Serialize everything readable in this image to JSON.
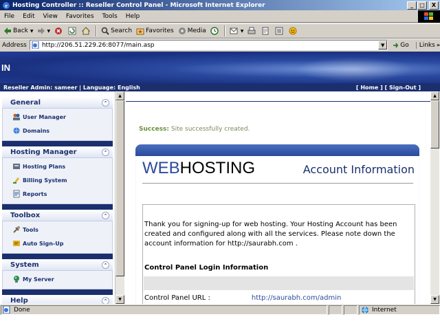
{
  "window": {
    "title": "Hosting Controller :: Reseller Control Panel - Microsoft Internet Explorer",
    "minimize": "_",
    "maximize": "□",
    "close": "X"
  },
  "menubar": {
    "items": [
      "File",
      "Edit",
      "View",
      "Favorites",
      "Tools",
      "Help"
    ]
  },
  "toolbar": {
    "back": "Back",
    "search": "Search",
    "favorites": "Favorites",
    "media": "Media"
  },
  "address": {
    "label": "Address",
    "url": "http://206.51.229.26:8077/main.asp",
    "go": "Go",
    "links": "Links"
  },
  "banner": {
    "logo": "IN"
  },
  "userbar": {
    "left": "Reseller Admin: sameer | Language: English",
    "right": "[ Home ] [ Sign-Out ]"
  },
  "sidebar": {
    "sections": [
      {
        "title": "General",
        "items": [
          {
            "label": "User Manager",
            "icon": "users-icon"
          },
          {
            "label": "Domains",
            "icon": "domains-icon"
          }
        ]
      },
      {
        "title": "Hosting Manager",
        "items": [
          {
            "label": "Hosting Plans",
            "icon": "plans-icon"
          },
          {
            "label": "Billing System",
            "icon": "billing-icon"
          },
          {
            "label": "Reports",
            "icon": "reports-icon"
          }
        ]
      },
      {
        "title": "Toolbox",
        "items": [
          {
            "label": "Tools",
            "icon": "tools-icon"
          },
          {
            "label": "Auto Sign-Up",
            "icon": "signup-icon"
          }
        ]
      },
      {
        "title": "System",
        "items": [
          {
            "label": "My Server",
            "icon": "server-icon"
          }
        ]
      },
      {
        "title": "Help",
        "items": []
      }
    ]
  },
  "main": {
    "success_label": "Success:",
    "success_text": "Site successfully created.",
    "brand_web": "WEB",
    "brand_hosting": "HOSTING",
    "heading": "Account Information",
    "message": "Thank you for signing-up for web hosting. Your Hosting Account has been created and configured along with all the services. Please note down the account information for http://saurabh.com .",
    "section_title": "Control Panel Login Information",
    "cp_url_label": "Control Panel URL :",
    "cp_url_value": "http://saurabh.com/admin"
  },
  "statusbar": {
    "status": "Done",
    "zone": "Internet"
  },
  "colors": {
    "navy": "#1b2f6e",
    "title_gradient_start": "#0a246a",
    "success_green": "#6b8f3b"
  }
}
